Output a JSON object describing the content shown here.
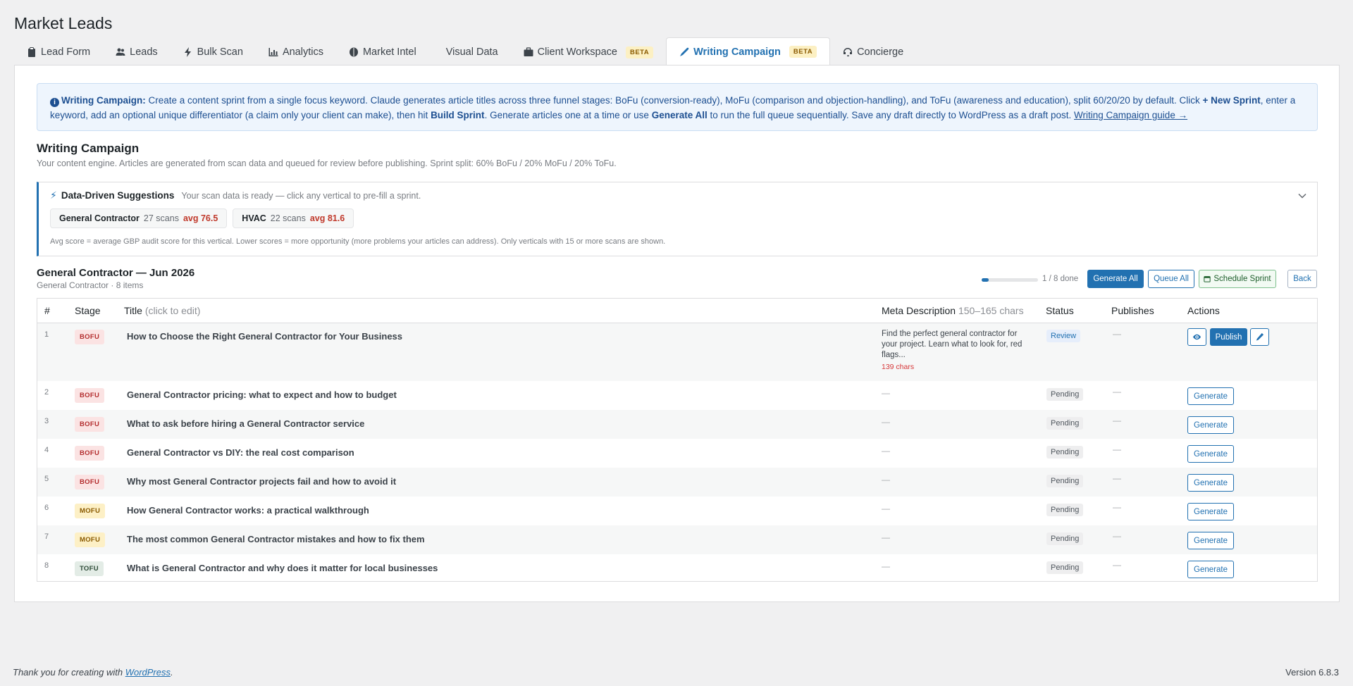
{
  "page": {
    "title": "Market Leads"
  },
  "tabs": [
    {
      "label": "Lead Form",
      "icon": "clipboard-icon",
      "beta": ""
    },
    {
      "label": "Leads",
      "icon": "users-icon",
      "beta": ""
    },
    {
      "label": "Bulk Scan",
      "icon": "bolt-icon",
      "beta": ""
    },
    {
      "label": "Analytics",
      "icon": "chart-icon",
      "beta": ""
    },
    {
      "label": "Market Intel",
      "icon": "brain-icon",
      "beta": ""
    },
    {
      "label": "Visual Data",
      "icon": "",
      "beta": ""
    },
    {
      "label": "Client Workspace",
      "icon": "briefcase-icon",
      "beta": "BETA"
    },
    {
      "label": "Writing Campaign",
      "icon": "pen-icon",
      "beta": "BETA",
      "active": true
    },
    {
      "label": "Concierge",
      "icon": "headset-icon",
      "beta": ""
    }
  ],
  "info": {
    "lead": "Writing Campaign:",
    "p1": " Create a content sprint from a single focus keyword. Claude generates article titles across three funnel stages: BoFu (conversion-ready), MoFu (comparison and objection-handling), and ToFu (awareness and education), split 60/20/20 by default. Click ",
    "b1": "+ New Sprint",
    "p2": ", enter a keyword, add an optional unique differentiator (a claim only your client can make), then hit ",
    "b2": "Build Sprint",
    "p3": ". Generate articles one at a time or use ",
    "b3": "Generate All",
    "p4": " to run the full queue sequentially. Save any draft directly to WordPress as a draft post. ",
    "link": "Writing Campaign guide →"
  },
  "section": {
    "title": "Writing Campaign",
    "subtitle": "Your content engine. Articles are generated from scan data and queued for review before publishing. Sprint split: 60% BoFu / 20% MoFu / 20% ToFu."
  },
  "suggestions": {
    "title": "Data-Driven Suggestions",
    "subtitle": "Your scan data is ready — click any vertical to pre-fill a sprint.",
    "chips": [
      {
        "name": "General Contractor",
        "scans": "27 scans",
        "avg": "avg 76.5"
      },
      {
        "name": "HVAC",
        "scans": "22 scans",
        "avg": "avg 81.6"
      }
    ],
    "note": "Avg score = average GBP audit score for this vertical. Lower scores = more opportunity (more problems your articles can address). Only verticals with 15 or more scans are shown."
  },
  "sprint": {
    "title": "General Contractor — Jun 2026",
    "subtitle": "General Contractor · 8 items",
    "progress": 0.125,
    "progress_text": "1 / 8 done",
    "generate_all": "Generate All",
    "queue_all": "Queue All",
    "schedule": "Schedule Sprint",
    "back": "Back"
  },
  "table": {
    "headers": {
      "num": "#",
      "stage": "Stage",
      "title": "Title",
      "title_hint": "(click to edit)",
      "meta": "Meta Description",
      "meta_hint": "150–165 chars",
      "status": "Status",
      "publishes": "Publishes",
      "actions": "Actions"
    },
    "rows": [
      {
        "num": "1",
        "stage": "BOFU",
        "title": "How to Choose the Right General Contractor for Your Business",
        "meta": "Find the perfect general contractor for your project. Learn what to look for, red flags...",
        "chars": "139 chars",
        "status": "Review",
        "publishes": "—",
        "action": "Publish"
      },
      {
        "num": "2",
        "stage": "BOFU",
        "title": "General Contractor pricing: what to expect and how to budget",
        "meta": "—",
        "status": "Pending",
        "publishes": "—",
        "action": "Generate"
      },
      {
        "num": "3",
        "stage": "BOFU",
        "title": "What to ask before hiring a General Contractor service",
        "meta": "—",
        "status": "Pending",
        "publishes": "—",
        "action": "Generate"
      },
      {
        "num": "4",
        "stage": "BOFU",
        "title": "General Contractor vs DIY: the real cost comparison",
        "meta": "—",
        "status": "Pending",
        "publishes": "—",
        "action": "Generate"
      },
      {
        "num": "5",
        "stage": "BOFU",
        "title": "Why most General Contractor projects fail and how to avoid it",
        "meta": "—",
        "status": "Pending",
        "publishes": "—",
        "action": "Generate"
      },
      {
        "num": "6",
        "stage": "MOFU",
        "title": "How General Contractor works: a practical walkthrough",
        "meta": "—",
        "status": "Pending",
        "publishes": "—",
        "action": "Generate"
      },
      {
        "num": "7",
        "stage": "MOFU",
        "title": "The most common General Contractor mistakes and how to fix them",
        "meta": "—",
        "status": "Pending",
        "publishes": "—",
        "action": "Generate"
      },
      {
        "num": "8",
        "stage": "TOFU",
        "title": "What is General Contractor and why does it matter for local businesses",
        "meta": "—",
        "status": "Pending",
        "publishes": "—",
        "action": "Generate"
      }
    ]
  },
  "footer": {
    "thanks": "Thank you for creating with ",
    "wp": "WordPress",
    "dot": ".",
    "version": "Version 6.8.3"
  }
}
